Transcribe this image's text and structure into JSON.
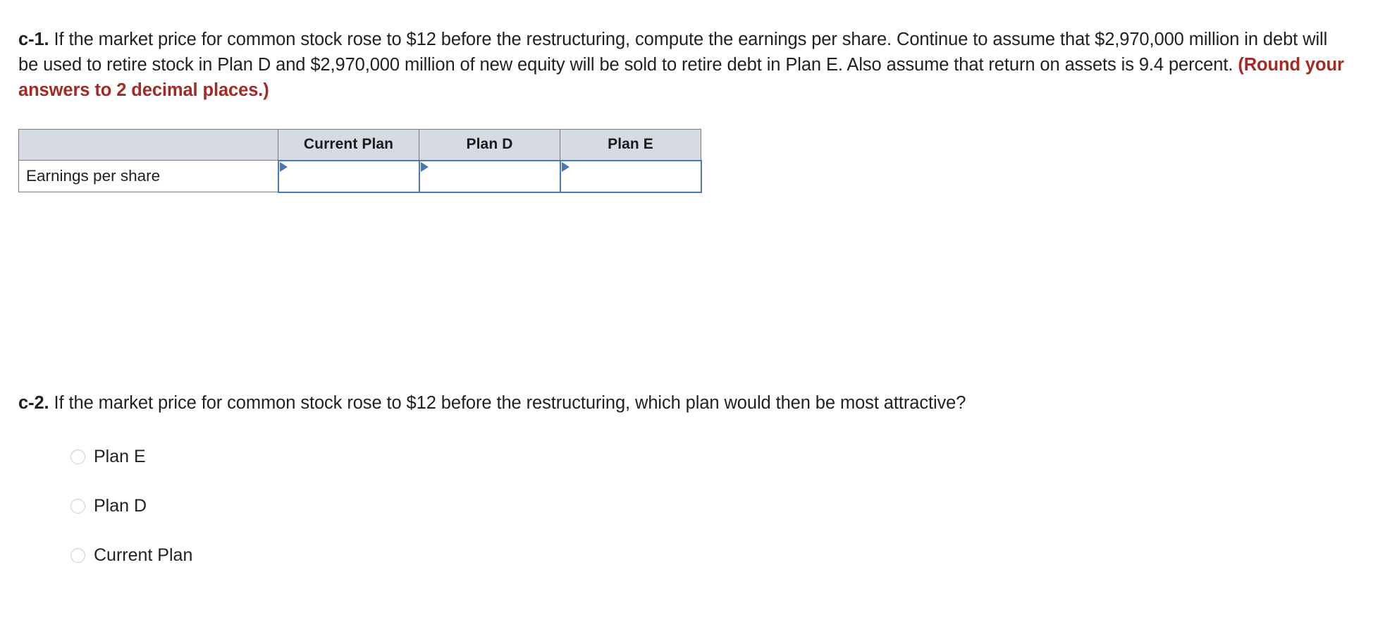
{
  "questions": {
    "c1": {
      "label": "c-1.",
      "body": "If the market price for common stock rose to $12 before the restructuring, compute the earnings per share. Continue to assume that $2,970,000 million in debt will be used to retire stock in Plan D and $2,970,000 million of new equity will be sold to retire debt in Plan E. Also assume that return on assets is 9.4 percent.",
      "emphasis": "(Round your answers to 2 decimal places.)"
    },
    "c2": {
      "label": "c-2.",
      "body": "If the market price for common stock rose to $12 before the restructuring, which plan would then be most attractive?"
    }
  },
  "table": {
    "headers": [
      "",
      "Current Plan",
      "Plan D",
      "Plan E"
    ],
    "rows": [
      {
        "label": "Earnings per share",
        "values": [
          "",
          "",
          ""
        ]
      }
    ]
  },
  "options": [
    {
      "label": "Plan E",
      "selected": false
    },
    {
      "label": "Plan D",
      "selected": false
    },
    {
      "label": "Current Plan",
      "selected": false
    }
  ],
  "colors": {
    "emphasis_red": "#a42a26",
    "header_fill": "#d5dae3",
    "table_border": "#7c7c7c",
    "input_border": "#4878b8",
    "flag_blue": "#4878b8",
    "text": "#231f20"
  }
}
